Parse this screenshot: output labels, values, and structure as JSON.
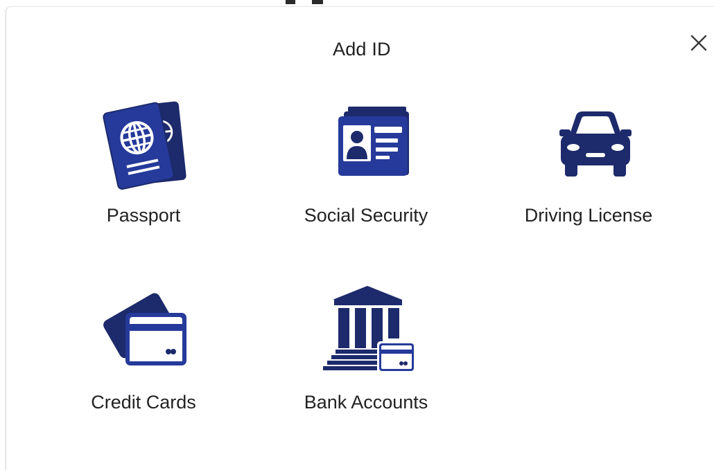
{
  "dialog": {
    "title": "Add ID",
    "close_label": "×"
  },
  "options": [
    {
      "label": "Passport",
      "icon": "passport-icon"
    },
    {
      "label": "Social Security",
      "icon": "id-card-icon"
    },
    {
      "label": "Driving License",
      "icon": "car-icon"
    },
    {
      "label": "Credit Cards",
      "icon": "credit-card-icon"
    },
    {
      "label": "Bank Accounts",
      "icon": "bank-icon"
    }
  ],
  "colors": {
    "icon_navy": "#1d2a6b",
    "icon_blue": "#253a9a",
    "text": "#222222",
    "background": "#ffffff"
  }
}
